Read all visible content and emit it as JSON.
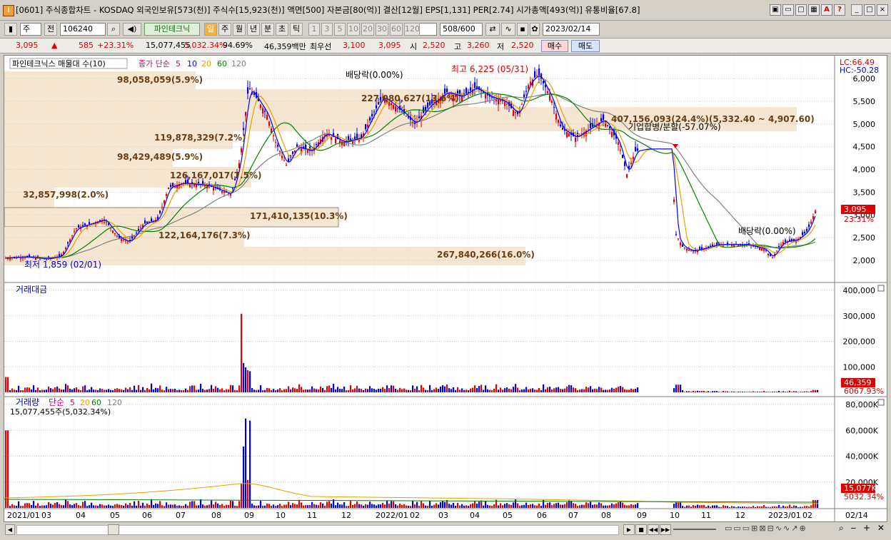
{
  "window": {
    "title": "[0601] 주식종합차트 - KOSDAQ 외국인보유[573(천)] 주식수[15,923(천)] 액면[500] 자본금[80(억)] 결산[12월] EPS[1,131] PER[2.74] 시가총액[493(억)] 유통비율[67.8]"
  },
  "toolbar": {
    "market": "주",
    "tab_all": "전",
    "code": "106240",
    "indicator": "파인테크닉",
    "periods": [
      "일",
      "주",
      "월",
      "년",
      "분",
      "초",
      "틱"
    ],
    "minutes": [
      "1",
      "3",
      "5",
      "10",
      "20",
      "30",
      "60",
      "120"
    ],
    "count": "508",
    "count_total": "/600",
    "date": "2023/02/14"
  },
  "quote": {
    "price": "3,095",
    "change": "585",
    "change_pct": "+23.31%",
    "volume": "15,077,455",
    "volume_ratio": "5,032.34%",
    "ratio2": "94.69%",
    "amount": "46,359백만",
    "label_best": "최우선",
    "best_ask": "3,100",
    "best_bid": "3,095",
    "label_open": "시",
    "open": "2,520",
    "label_high": "고",
    "high": "3,260",
    "label_low": "저",
    "low": "2,520",
    "buy": "매수",
    "sell": "매도"
  },
  "price_panel": {
    "legend_name": "파인테크닉스 매물대 수(10)",
    "legend_ma": "종가 단순",
    "ma_periods": [
      "5",
      "10",
      "20",
      "60",
      "120"
    ],
    "ma_colors": [
      "#c8007a",
      "#0000ff",
      "#e8a000",
      "#008000",
      "#808080"
    ],
    "lc": "LC:66.49",
    "hc": "HC:-50.28",
    "current_price": "3,095",
    "current_pct": "23.31%",
    "y_ticks": [
      "6,000",
      "5,500",
      "5,000",
      "4,500",
      "4,000",
      "3,500",
      "3,000",
      "2,500",
      "2,000"
    ],
    "volume_profile": [
      {
        "label": "98,058,059(5.9%)"
      },
      {
        "label": "227,080,627(13.6%)"
      },
      {
        "label": "407,156,093(24.4%)(5,332.40 ~ 4,907.60)"
      },
      {
        "label": "119,878,329(7.2%)"
      },
      {
        "label": "98,429,489(5.9%)"
      },
      {
        "label": "126,167,017(7.5%)"
      },
      {
        "label": "32,857,998(2.0%)"
      },
      {
        "label": "171,410,135(10.3%)"
      },
      {
        "label": "122,164,176(7.3%)"
      },
      {
        "label": "267,840,266(16.0%)"
      }
    ],
    "annotations": {
      "dividend1": "배당락(0.00%)",
      "high": "최고 6,225 (05/31)",
      "merger": "기업합병/분할(-57.07%)",
      "dividend2": "배당락(0.00%)",
      "low": "최저 1,859 (02/01)"
    }
  },
  "amount_panel": {
    "title": "거래대금",
    "y_ticks": [
      "400,000",
      "300,000",
      "200,000",
      "100,000"
    ],
    "current": "46,359",
    "pct": "6067.93%"
  },
  "volume_panel": {
    "title": "거래량",
    "legend_ma": "단순",
    "ma_periods": [
      "5",
      "20",
      "60",
      "120"
    ],
    "sub": "15,077,455주(5,032.34%)",
    "y_ticks": [
      "80,000K",
      "60,000K",
      "40,000K",
      "20,000K"
    ],
    "current": "15,077K",
    "pct": "5032.34%"
  },
  "x_axis": [
    "2021/01",
    "03",
    "04",
    "05",
    "06",
    "07",
    "08",
    "09",
    "10",
    "11",
    "12",
    "2022/01",
    "02",
    "03",
    "04",
    "05",
    "06",
    "07",
    "08",
    "09",
    "10",
    "11",
    "12",
    "2023/01",
    "02",
    "02/14"
  ],
  "chart_data": {
    "type": "candlestick",
    "series": [
      {
        "name": "파인테크닉스",
        "x": [
          "2021/01",
          "2021/03",
          "2021/05",
          "2021/07",
          "2021/09",
          "2021/11",
          "2022/01",
          "2022/03",
          "2022/05",
          "2022/07",
          "2022/09",
          "2022/10",
          "2022/12",
          "2023/02/14"
        ],
        "values": [
          2050,
          2800,
          2400,
          3700,
          5800,
          4300,
          5400,
          5700,
          6100,
          4900,
          4450,
          2300,
          2350,
          3095
        ]
      }
    ],
    "ylim": [
      1800,
      6300
    ]
  }
}
